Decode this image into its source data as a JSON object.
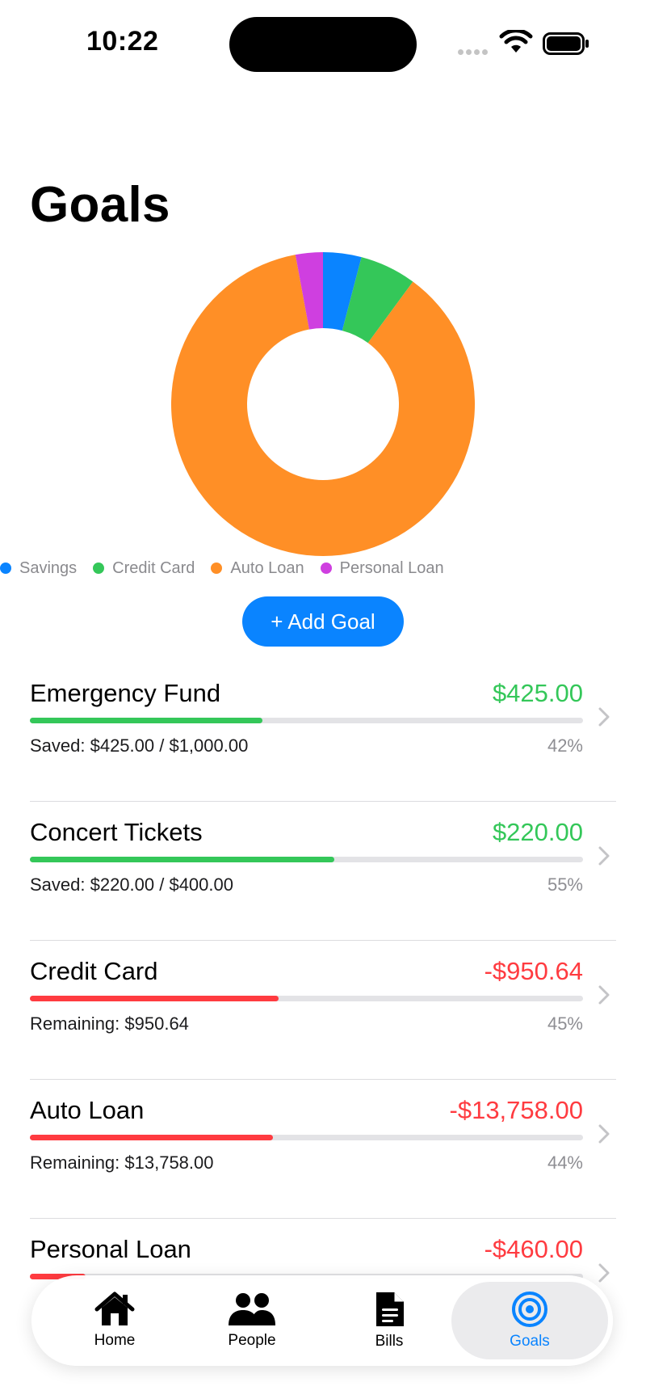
{
  "status": {
    "time": "10:22"
  },
  "page": {
    "title": "Goals"
  },
  "chart_data": {
    "type": "pie",
    "categories": [
      "Savings",
      "Credit Card",
      "Auto Loan",
      "Personal Loan"
    ],
    "values": [
      645,
      950.64,
      13758,
      460
    ],
    "colors": [
      "#0a84ff",
      "#34c759",
      "#ff8f26",
      "#cf3fe0"
    ],
    "legend": "bottom"
  },
  "actions": {
    "add_goal": "+ Add Goal"
  },
  "goals": [
    {
      "name": "Emergency Fund",
      "amount": "$425.00",
      "detail": "Saved: $425.00 / $1,000.00",
      "percent": "42%",
      "progress": 0.42,
      "color": "#34c759"
    },
    {
      "name": "Concert Tickets",
      "amount": "$220.00",
      "detail": "Saved: $220.00 / $400.00",
      "percent": "55%",
      "progress": 0.55,
      "color": "#34c759"
    },
    {
      "name": "Credit Card",
      "amount": "-$950.64",
      "detail": "Remaining: $950.64",
      "percent": "45%",
      "progress": 0.45,
      "color": "#ff3b40"
    },
    {
      "name": "Auto Loan",
      "amount": "-$13,758.00",
      "detail": "Remaining: $13,758.00",
      "percent": "44%",
      "progress": 0.44,
      "color": "#ff3b40"
    },
    {
      "name": "Personal Loan",
      "amount": "-$460.00",
      "detail": "",
      "percent": "",
      "progress": 0.1,
      "color": "#ff3b40"
    }
  ],
  "tabs": [
    {
      "label": "Home",
      "icon": "house-icon",
      "active": false
    },
    {
      "label": "People",
      "icon": "people-icon",
      "active": false
    },
    {
      "label": "Bills",
      "icon": "document-icon",
      "active": false
    },
    {
      "label": "Goals",
      "icon": "target-icon",
      "active": true
    }
  ]
}
